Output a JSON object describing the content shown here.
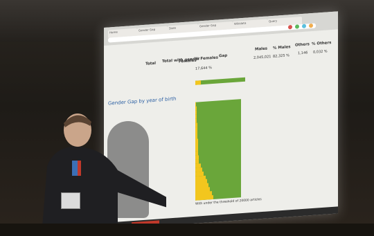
{
  "header": {
    "col_total": "Total",
    "col_women": "Total with gender",
    "col_females": "Females",
    "col_pct_females": "% Females",
    "col_gap": "Gap",
    "col_males": "Males",
    "col_pct_males": "% Males",
    "col_others": "Others",
    "col_pct_others": "% Others"
  },
  "summary": {
    "pct_females": "17,644 %",
    "males": "2,045,021",
    "pct_males": "82,325 %",
    "others": "1,146",
    "pct_others": "0,032 %"
  },
  "section_title": "Gender Gap by year of birth",
  "chart_caption": "With under the threshold of 20000 articles",
  "colors": {
    "green": "#6aa63a",
    "yellow": "#f2c61e",
    "screen": "#eeeeea"
  }
}
